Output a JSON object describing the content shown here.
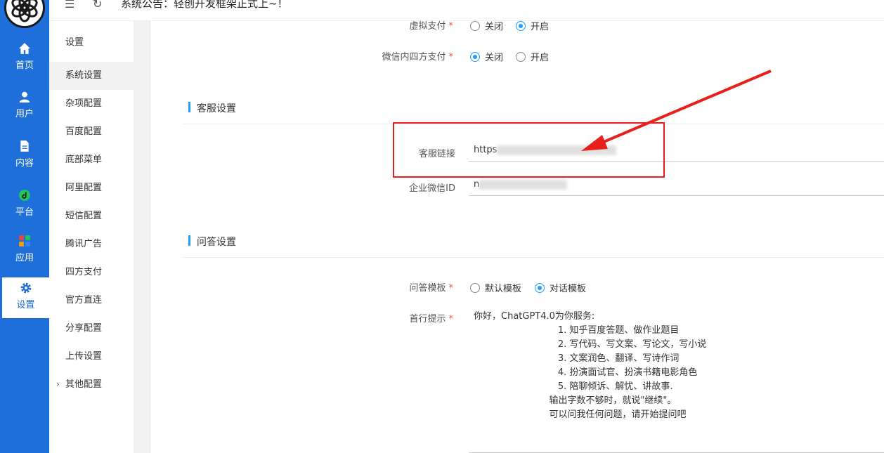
{
  "leftnav": {
    "items": [
      {
        "label": "首页",
        "icon": "home-icon"
      },
      {
        "label": "用户",
        "icon": "user-icon"
      },
      {
        "label": "内容",
        "icon": "document-icon"
      },
      {
        "label": "平台",
        "icon": "platform-icon"
      },
      {
        "label": "应用",
        "icon": "apps-icon"
      },
      {
        "label": "设置",
        "icon": "gear-icon"
      }
    ],
    "active": "设置"
  },
  "topbar": {
    "notice": "系统公告：轻创开发框架正式上~！"
  },
  "subnav": {
    "head": "设置",
    "items": [
      "系统设置",
      "杂项配置",
      "百度配置",
      "底部菜单",
      "阿里配置",
      "短信配置",
      "腾讯广告",
      "四方支付",
      "官方直连",
      "分享配置",
      "上传设置",
      "其他配置"
    ],
    "active": "系统设置"
  },
  "form": {
    "virtual_pay": {
      "label": "虚拟支付",
      "options": [
        "关闭",
        "开启"
      ],
      "selected": "开启"
    },
    "wechat_pay": {
      "label": "微信内四方支付",
      "options": [
        "关闭",
        "开启"
      ],
      "selected": "关闭"
    },
    "service_section": "客服设置",
    "service_link": {
      "label": "客服链接",
      "value_prefix": "https"
    },
    "corp_wechat_id": {
      "label": "企业微信ID",
      "value_prefix": "n"
    },
    "qa_section": "问答设置",
    "qa_template": {
      "label": "问答模板",
      "options": [
        "默认模板",
        "对话模板"
      ],
      "selected": "对话模板"
    },
    "first_prompt": {
      "label": "首行提示",
      "lines": [
        "你好，ChatGPT4.0为你服务:",
        "                             1. 知乎百度答题、做作业题目",
        "                             2. 写代码、写文案、写论文，写小说",
        "                             3. 文案润色、翻译、写诗作词",
        "                             4. 扮演面试官、扮演书籍电影角色",
        "                             5. 陪聊倾诉、解忧、讲故事.",
        "                          输出字数不够时，就说\"继续\"。",
        "                          可以问我任何问题，请开始提问吧"
      ]
    }
  },
  "colors": {
    "primary": "#1e6fd9",
    "accent": "#1e9fff",
    "annotation": "#e8201c"
  }
}
